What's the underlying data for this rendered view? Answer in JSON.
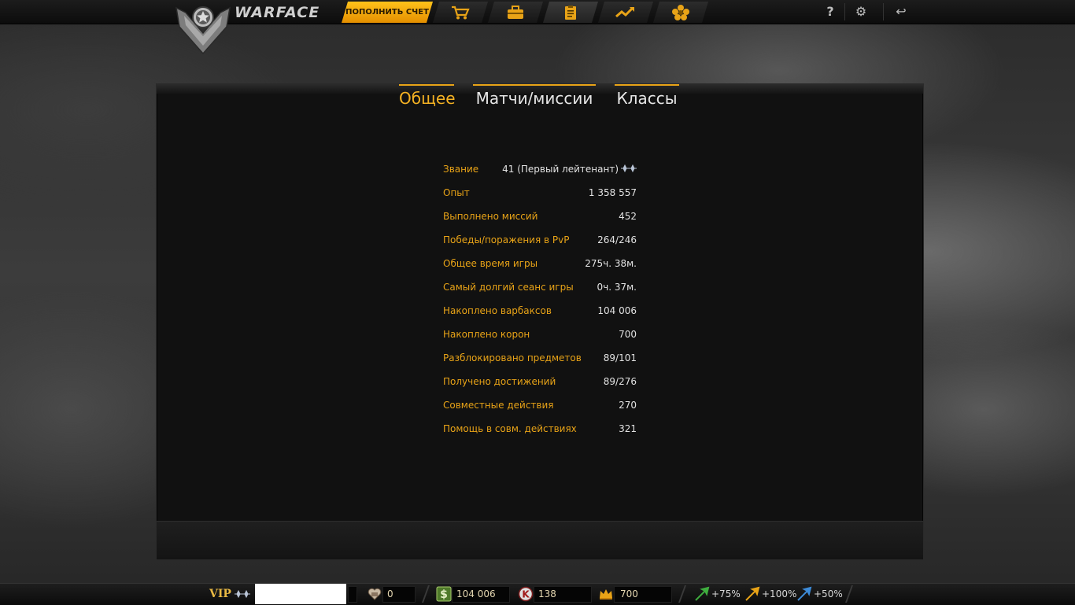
{
  "header": {
    "logo_text": "WARFACE",
    "fund_button": "ПОПОЛНИТЬ СЧЕТ",
    "nav": [
      {
        "name": "shop-cart-icon"
      },
      {
        "name": "inventory-briefcase-icon"
      },
      {
        "name": "profile-clipboard-icon",
        "active": true
      },
      {
        "name": "ratings-trend-icon"
      },
      {
        "name": "achievements-flower-icon"
      }
    ],
    "help_icon": "?",
    "settings_icon": "⚙",
    "exit_icon": "↩"
  },
  "tabs": [
    {
      "label": "Общее",
      "active": true
    },
    {
      "label": "Матчи/миссии",
      "active": false
    },
    {
      "label": "Классы",
      "active": false
    }
  ],
  "stats": [
    {
      "label": "Звание",
      "value": "41 (Первый лейтенант)"
    },
    {
      "label": "Опыт",
      "value": "1 358 557"
    },
    {
      "label": "Выполнено миссий",
      "value": "452"
    },
    {
      "label": "Победы/поражения в PvP",
      "value": "264/246"
    },
    {
      "label": "Общее время игры",
      "value": "275ч. 38м."
    },
    {
      "label": "Самый долгий сеанс игры",
      "value": "0ч. 37м."
    },
    {
      "label": "Накоплено варбаксов",
      "value": "104 006"
    },
    {
      "label": "Накоплено корон",
      "value": "700"
    },
    {
      "label": "Разблокировано предметов",
      "value": "89/101"
    },
    {
      "label": "Получено достижений",
      "value": "89/276"
    },
    {
      "label": "Совместные действия",
      "value": "270"
    },
    {
      "label": "Помощь в совм. действиях",
      "value": "321"
    }
  ],
  "bottombar": {
    "vip_label": "VIP",
    "gift_value": "0",
    "warbucks_value": "104 006",
    "kredits_value": "138",
    "crowns_value": "700",
    "boost_xp": "+75%",
    "boost_money": "+100%",
    "boost_vp": "+50%"
  },
  "colors": {
    "accent": "#e8a317",
    "value_text": "#e2e2e2",
    "panel_bg": "#111111"
  }
}
